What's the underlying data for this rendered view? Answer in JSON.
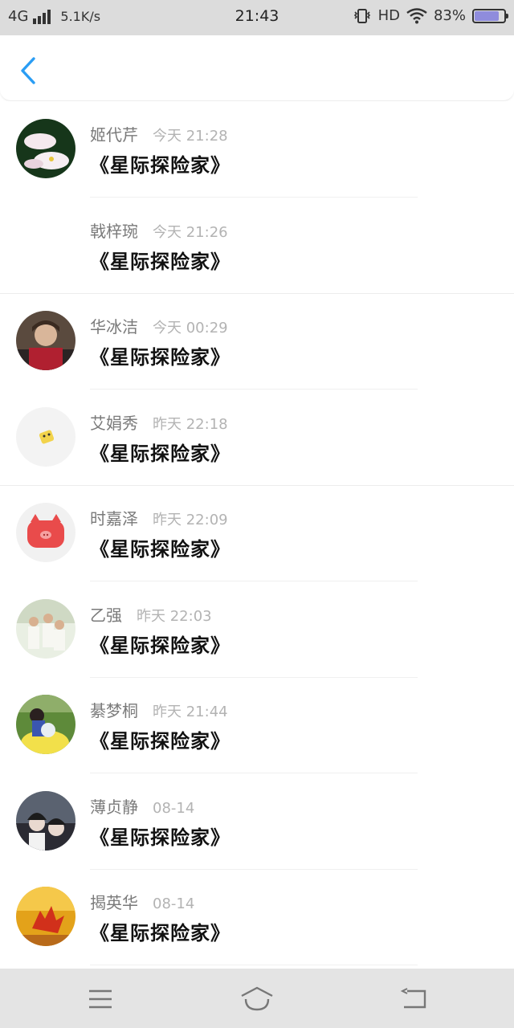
{
  "status_bar": {
    "network": "4G",
    "speed": "5.1K/s",
    "time": "21:43",
    "hd": "HD",
    "battery_percent": "83%",
    "battery_level": 0.83,
    "battery_color": "#8f8cdc",
    "icons": [
      "signal-icon",
      "vibrate-icon",
      "wifi-icon",
      "battery-icon"
    ]
  },
  "header": {
    "back_icon": "chevron-left-icon",
    "accent": "#2a9df4"
  },
  "items": [
    {
      "name": "姬代芹",
      "time": "今天 21:28",
      "title": "《星际探险家》",
      "avatar": "lotus"
    },
    {
      "name": "戟梓琬",
      "time": "今天 21:26",
      "title": "《星际探险家》",
      "avatar": "none"
    },
    {
      "name": "华冰洁",
      "time": "今天 00:29",
      "title": "《星际探险家》",
      "avatar": "person-dark"
    },
    {
      "name": "艾娟秀",
      "time": "昨天 22:18",
      "title": "《星际探险家》",
      "avatar": "sticker"
    },
    {
      "name": "时嘉泽",
      "time": "昨天 22:09",
      "title": "《星际探险家》",
      "avatar": "pig"
    },
    {
      "name": "乙强",
      "time": "昨天 22:03",
      "title": "《星际探险家》",
      "avatar": "group"
    },
    {
      "name": "綦梦桐",
      "time": "昨天 21:44",
      "title": "《星际探险家》",
      "avatar": "child-grass"
    },
    {
      "name": "薄贞静",
      "time": "08-14",
      "title": "《星际探险家》",
      "avatar": "couple"
    },
    {
      "name": "揭英华",
      "time": "08-14",
      "title": "《星际探险家》",
      "avatar": "autumn-leaf"
    }
  ],
  "nav_bar": {
    "icons": [
      "menu-icon",
      "home-icon",
      "back-arrow-icon"
    ]
  }
}
